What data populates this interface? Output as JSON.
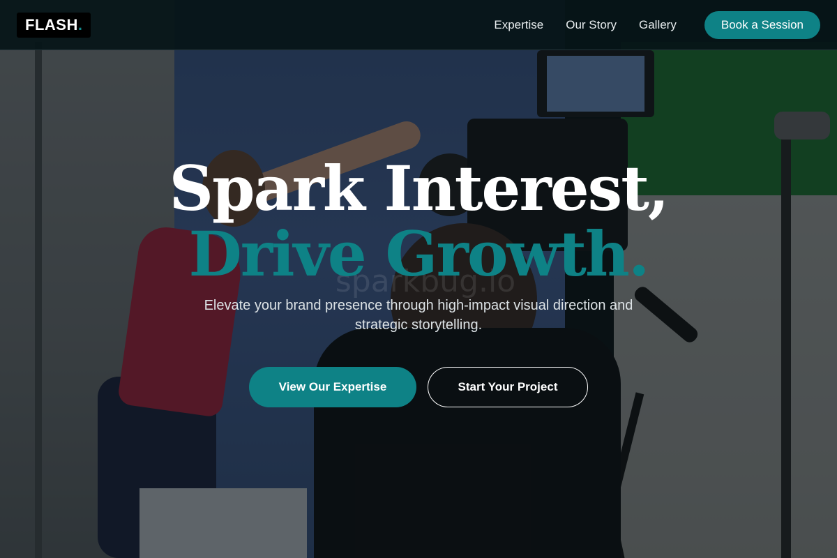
{
  "nav": {
    "logo_text": "FLASH",
    "logo_dot": ".",
    "links": [
      "Expertise",
      "Our Story",
      "Gallery"
    ],
    "cta_label": "Book a Session"
  },
  "hero": {
    "headline_line1": "Spark Interest,",
    "headline_line2": "Drive Growth.",
    "subtitle": "Elevate your brand presence through high-impact visual direction and strategic storytelling.",
    "primary_button": "View Our Expertise",
    "secondary_button": "Start Your Project",
    "background_image": "film-set-photo",
    "watermark": "sparkbug.io"
  },
  "colors": {
    "accent": "#0e8286",
    "nav_background": "#061418",
    "headline_white": "#ffffff"
  }
}
